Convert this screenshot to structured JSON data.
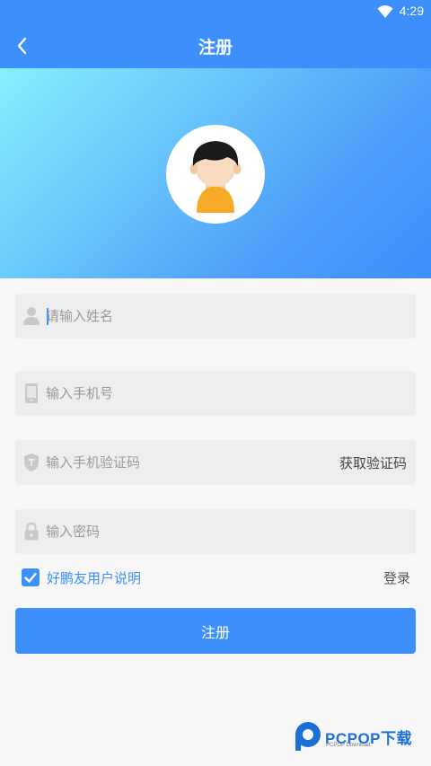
{
  "status_bar": {
    "time": "4:29"
  },
  "app_bar": {
    "title": "注册"
  },
  "form": {
    "name_placeholder": "请输入姓名",
    "phone_placeholder": "输入手机号",
    "code_placeholder": "输入手机验证码",
    "get_code_label": "获取验证码",
    "password_placeholder": "输入密码",
    "agree_label": "好鹏友用户说明",
    "agree_checked": true,
    "login_label": "登录",
    "submit_label": "注册"
  },
  "watermark": {
    "brand": "PCPOP下载",
    "sub": "PCPOP Download"
  },
  "colors": {
    "primary": "#3d8ffb",
    "gradient_start": "#86f0fd",
    "field_bg": "#eeeeee"
  }
}
